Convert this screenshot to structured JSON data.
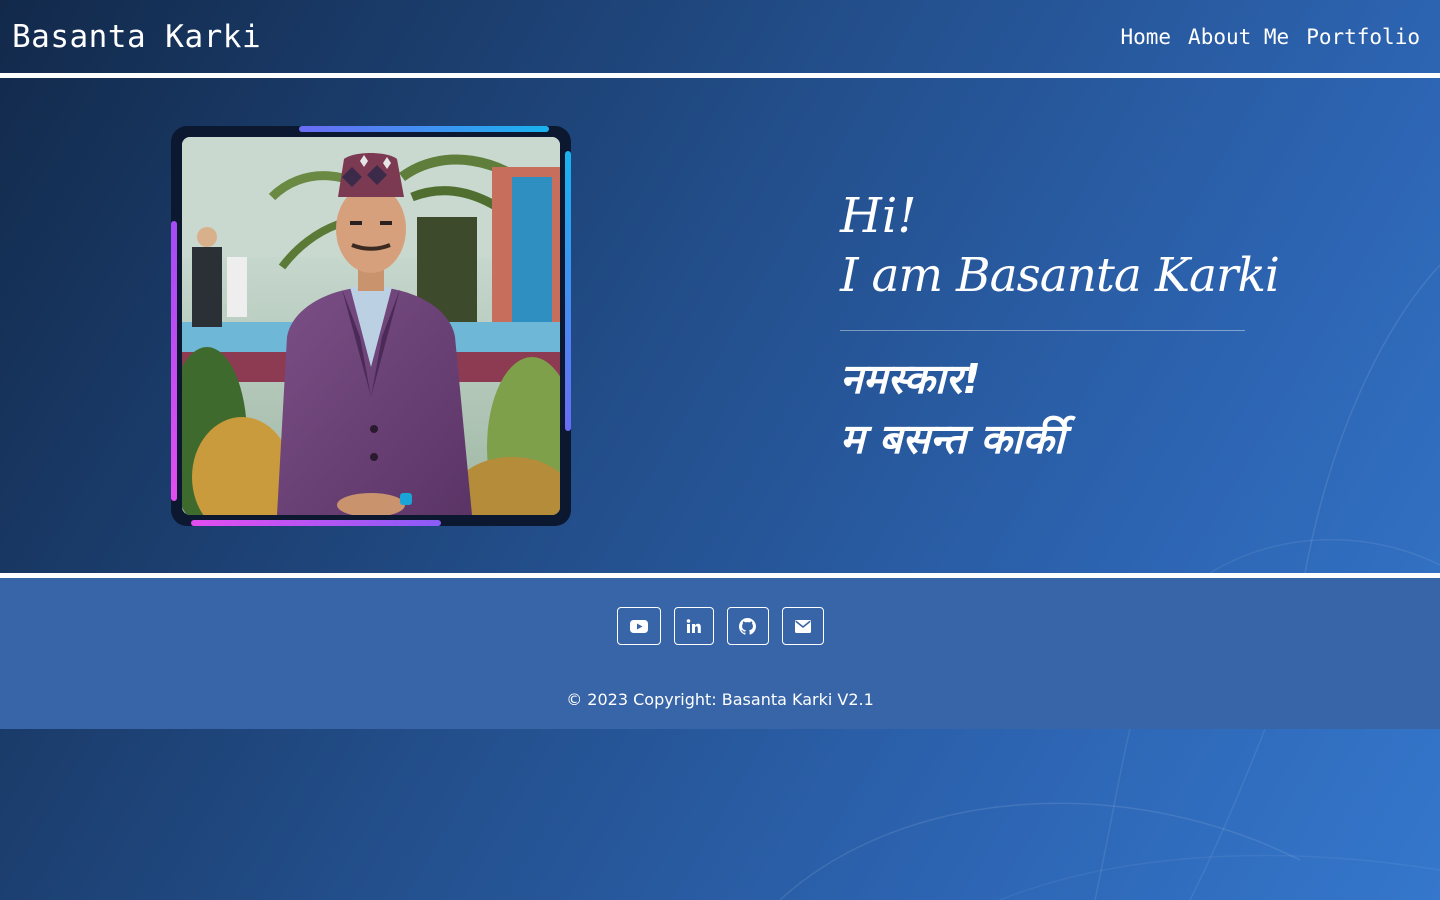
{
  "navbar": {
    "brand": "Basanta Karki",
    "links": [
      "Home",
      "About Me",
      "Portfolio"
    ]
  },
  "hero": {
    "photo_alt": "Portrait of Basanta Karki",
    "greeting_en": [
      "Hi!",
      "I am Basanta Karki"
    ],
    "greeting_np": [
      "नमस्कार!",
      "म बसन्त कार्की"
    ]
  },
  "footer": {
    "socials": [
      "youtube-icon",
      "linkedin-icon",
      "github-icon",
      "envelope-icon"
    ],
    "copyright": "© 2023 Copyright: Basanta Karki V2.1"
  },
  "colors": {
    "footer_bg": "#3865a7",
    "accent_cyan": "#19b3ef",
    "accent_magenta": "#e34df0",
    "accent_violet": "#6a6cf5"
  }
}
